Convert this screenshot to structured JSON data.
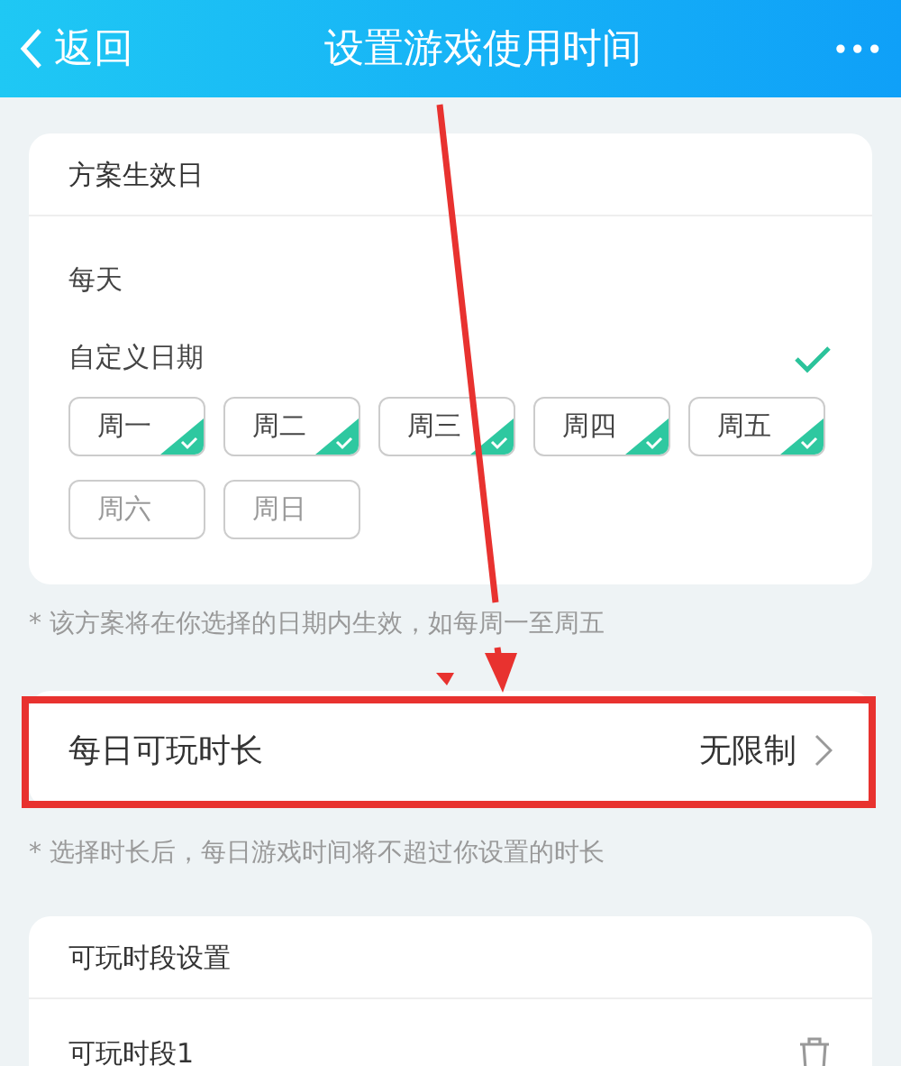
{
  "header": {
    "back": "返回",
    "title": "设置游戏使用时间",
    "more": "•••"
  },
  "effective_days": {
    "title": "方案生效日",
    "options": [
      {
        "label": "每天",
        "selected": false
      },
      {
        "label": "自定义日期",
        "selected": true
      }
    ],
    "days": [
      {
        "label": "周一",
        "selected": true
      },
      {
        "label": "周二",
        "selected": true
      },
      {
        "label": "周三",
        "selected": true
      },
      {
        "label": "周四",
        "selected": true
      },
      {
        "label": "周五",
        "selected": true
      },
      {
        "label": "周六",
        "selected": false
      },
      {
        "label": "周日",
        "selected": false
      }
    ]
  },
  "hint_1": "* 该方案将在你选择的日期内生效，如每周一至周五",
  "daily_limit": {
    "label": "每日可玩时长",
    "value": "无限制"
  },
  "hint_2": "* 选择时长后，每日游戏时间将不超过你设置的时长",
  "periods": {
    "title": "可玩时段设置",
    "items": [
      {
        "label": "可玩时段1"
      }
    ]
  },
  "annotations": {
    "highlight": true,
    "arrow": true
  }
}
